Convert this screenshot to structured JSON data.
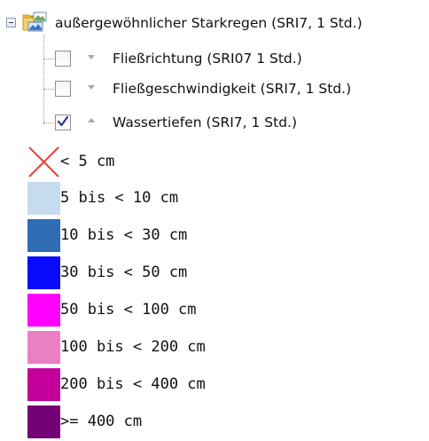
{
  "tree": {
    "group": {
      "label": "außergewöhnlicher Starkregen (SRI7, 1 Std.)",
      "expanded": true,
      "icon": "folder-layers-icon"
    },
    "layers": [
      {
        "label": "Fließrichtung (SRI07 1 Std.)",
        "checked": false,
        "expander": "chevron-down-icon"
      },
      {
        "label": "Fließgeschwindigkeit (SRI7, 1 Std.)",
        "checked": false,
        "expander": "chevron-down-icon"
      },
      {
        "label": "Wassertiefen (SRI7, 1 Std.)",
        "checked": true,
        "expander": "chevron-up-icon"
      }
    ]
  },
  "legend": {
    "items": [
      {
        "label": "< 5 cm",
        "symbol": "red-cross-icon",
        "color": "#e8413a"
      },
      {
        "label": "5 bis < 10 cm",
        "color": "#c6dbef"
      },
      {
        "label": "10 bis < 30 cm",
        "color": "#2f6db4"
      },
      {
        "label": "30 bis < 50 cm",
        "color": "#0a0aff"
      },
      {
        "label": "50 bis < 100 cm",
        "color": "#ff00ff"
      },
      {
        "label": "100 bis < 200 cm",
        "color": "#ea7fc4"
      },
      {
        "label": "200 bis < 400 cm",
        "color": "#c4009a"
      },
      {
        "label": ">= 400 cm",
        "color": "#740075"
      }
    ]
  }
}
